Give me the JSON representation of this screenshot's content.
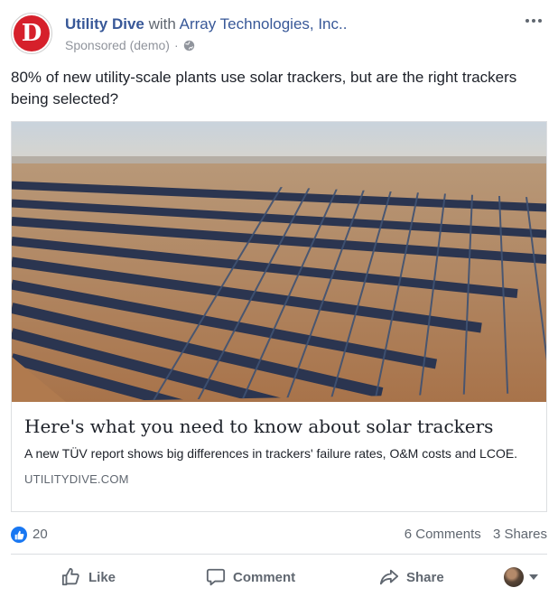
{
  "post": {
    "page_name": "Utility Dive",
    "with_word": "with",
    "partner_name": "Array Technologies, Inc..",
    "sponsored_label": "Sponsored (demo)",
    "separator": "·",
    "avatar_letter": "D",
    "text": "80% of new utility-scale plants use solar trackers, but are the right trackers being selected?"
  },
  "link": {
    "title": "Here's what you need to know about solar trackers",
    "description": "A new TÜV report shows big differences in trackers' failure rates, O&M costs and LCOE.",
    "domain": "UTILITYDIVE.COM"
  },
  "stats": {
    "likes": "20",
    "comments": "6 Comments",
    "shares": "3 Shares"
  },
  "actions": {
    "like": "Like",
    "comment": "Comment",
    "share": "Share"
  },
  "icons": {
    "avatar": "utility-dive-logo",
    "globe": "globe-icon",
    "more": "more-options-icon",
    "like_reaction": "thumbs-up-icon",
    "like_action": "thumbs-up-outline-icon",
    "comment_action": "speech-bubble-icon",
    "share_action": "share-arrow-icon"
  },
  "colors": {
    "brand_link": "#385898",
    "logo_red": "#d6202b",
    "like_blue": "#1877f2",
    "secondary_text": "#606770"
  }
}
